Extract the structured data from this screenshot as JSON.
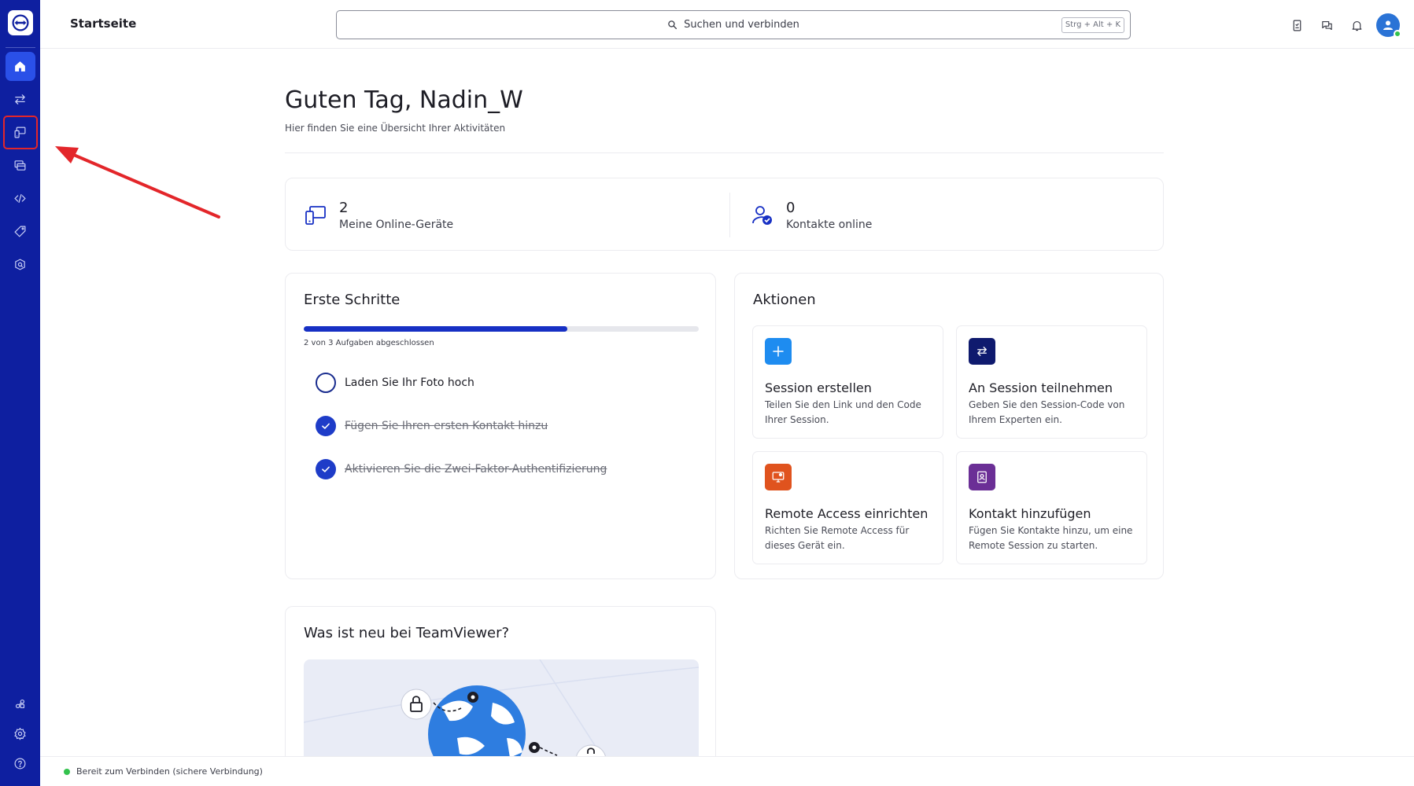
{
  "header": {
    "page_title": "Startseite",
    "search_placeholder": "Suchen und verbinden",
    "search_shortcut": "Strg + Alt + K"
  },
  "sidebar": {
    "items": [
      "home-icon",
      "transfer-icon",
      "devices-icon",
      "sessions-icon",
      "code-icon",
      "tag-icon",
      "scan-icon"
    ],
    "bottom_items": [
      "integrations-icon",
      "settings-icon",
      "help-icon"
    ],
    "highlighted": "devices-icon"
  },
  "greeting": {
    "title": "Guten Tag, Nadin_W",
    "subtitle": "Hier finden Sie eine Übersicht Ihrer Aktivitäten"
  },
  "stats": {
    "devices": {
      "value": "2",
      "label": "Meine Online-Geräte"
    },
    "contacts": {
      "value": "0",
      "label": "Kontakte online"
    }
  },
  "first_steps": {
    "title": "Erste Schritte",
    "progress": 0.667,
    "progress_text": "2 von 3 Aufgaben abgeschlossen",
    "tasks": [
      {
        "label": "Laden Sie Ihr Foto hoch",
        "done": false
      },
      {
        "label": "Fügen Sie Ihren ersten Kontakt hinzu",
        "done": true
      },
      {
        "label": "Aktivieren Sie die Zwei-Faktor-Authentifizierung",
        "done": true
      }
    ]
  },
  "actions": {
    "title": "Aktionen",
    "items": [
      {
        "title": "Session erstellen",
        "desc": "Teilen Sie den Link und den Code Ihrer Session.",
        "icon": "plus-icon",
        "color": "#1e8cf0"
      },
      {
        "title": "An Session teilnehmen",
        "desc": "Geben Sie den Session-Code von Ihrem Experten ein.",
        "icon": "join-icon",
        "color": "#0f1a6e"
      },
      {
        "title": "Remote Access einrichten",
        "desc": "Richten Sie Remote Access für dieses Gerät ein.",
        "icon": "remote-access-icon",
        "color": "#e0531e"
      },
      {
        "title": "Kontakt hinzufügen",
        "desc": "Fügen Sie Kontakte hinzu, um eine Remote Session zu starten.",
        "icon": "contact-icon",
        "color": "#6b2f96"
      }
    ]
  },
  "news": {
    "title": "Was ist neu bei TeamViewer?"
  },
  "status": {
    "text": "Bereit zum Verbinden (sichere Verbindung)",
    "color": "#33c24d"
  },
  "colors": {
    "sidebar": "#0e1fa0",
    "accent": "#1730c4",
    "annotation": "#e3262a"
  }
}
